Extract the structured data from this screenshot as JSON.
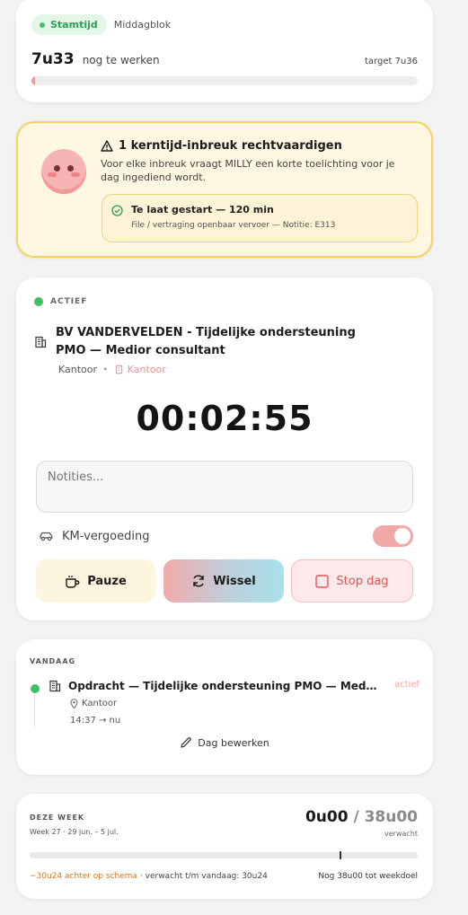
{
  "status_card": {
    "badge": "Stamtijd",
    "subtitle": "Middagblok",
    "remaining_value": "7u33",
    "remaining_label": "nog te werken",
    "target": "target 7u36",
    "progress_fraction": 0.01
  },
  "warning_card": {
    "title": "1 kerntijd-inbreuk rechtvaardigen",
    "description": "Voor elke inbreuk vraagt MILLY een korte toelichting voor je dag ingediend wordt.",
    "item_title": "Te laat gestart — 120 min",
    "item_detail": "File / vertraging openbaar vervoer — Notitie: E313",
    "colors": {
      "border": "#f3d35c",
      "background": "#fff7e1"
    }
  },
  "timer_card": {
    "status": "ACTIEF",
    "project_title": "BV VANDERVELDEN - Tijdelijke ondersteuning PMO — Medior consultant",
    "location": "Kantoor",
    "location_type": "Kantoor",
    "timer": "00:02:55",
    "notes_placeholder": "Notities...",
    "km_label": "KM-vergoeding",
    "km_enabled": true,
    "buttons": {
      "pause": "Pauze",
      "switch": "Wissel",
      "stop": "Stop dag"
    }
  },
  "today_card": {
    "label": "VANDAAG",
    "entry_title": "Opdracht — Tijdelijke ondersteuning PMO — Medior c...",
    "entry_tag": "actief",
    "entry_location": "Kantoor",
    "entry_time": "14:37 → nu",
    "edit_label": "Dag bewerken"
  },
  "week_card": {
    "label": "DEZE WEEK",
    "week_range": "Week 27 · 29 jun. – 5 jul.",
    "worked": "0u00",
    "expected_total": "/ 38u00",
    "expected_label": "verwacht",
    "behind": "−30u24 achter op schema",
    "expected_until_today": " · verwacht t/m vandaag: 30u24",
    "remaining": "Nog 38u00 tot weekdoel",
    "colors": {
      "behind": "#d9781f"
    }
  },
  "icons": [
    "warning-icon",
    "check-circle-icon",
    "building-icon",
    "location-pin-icon",
    "car-icon",
    "coffee-icon",
    "refresh-icon",
    "stop-square-icon",
    "pencil-icon",
    "mascot-face"
  ],
  "accent_colors": {
    "green": "#3fbf63",
    "pink": "#f3a8a8"
  }
}
